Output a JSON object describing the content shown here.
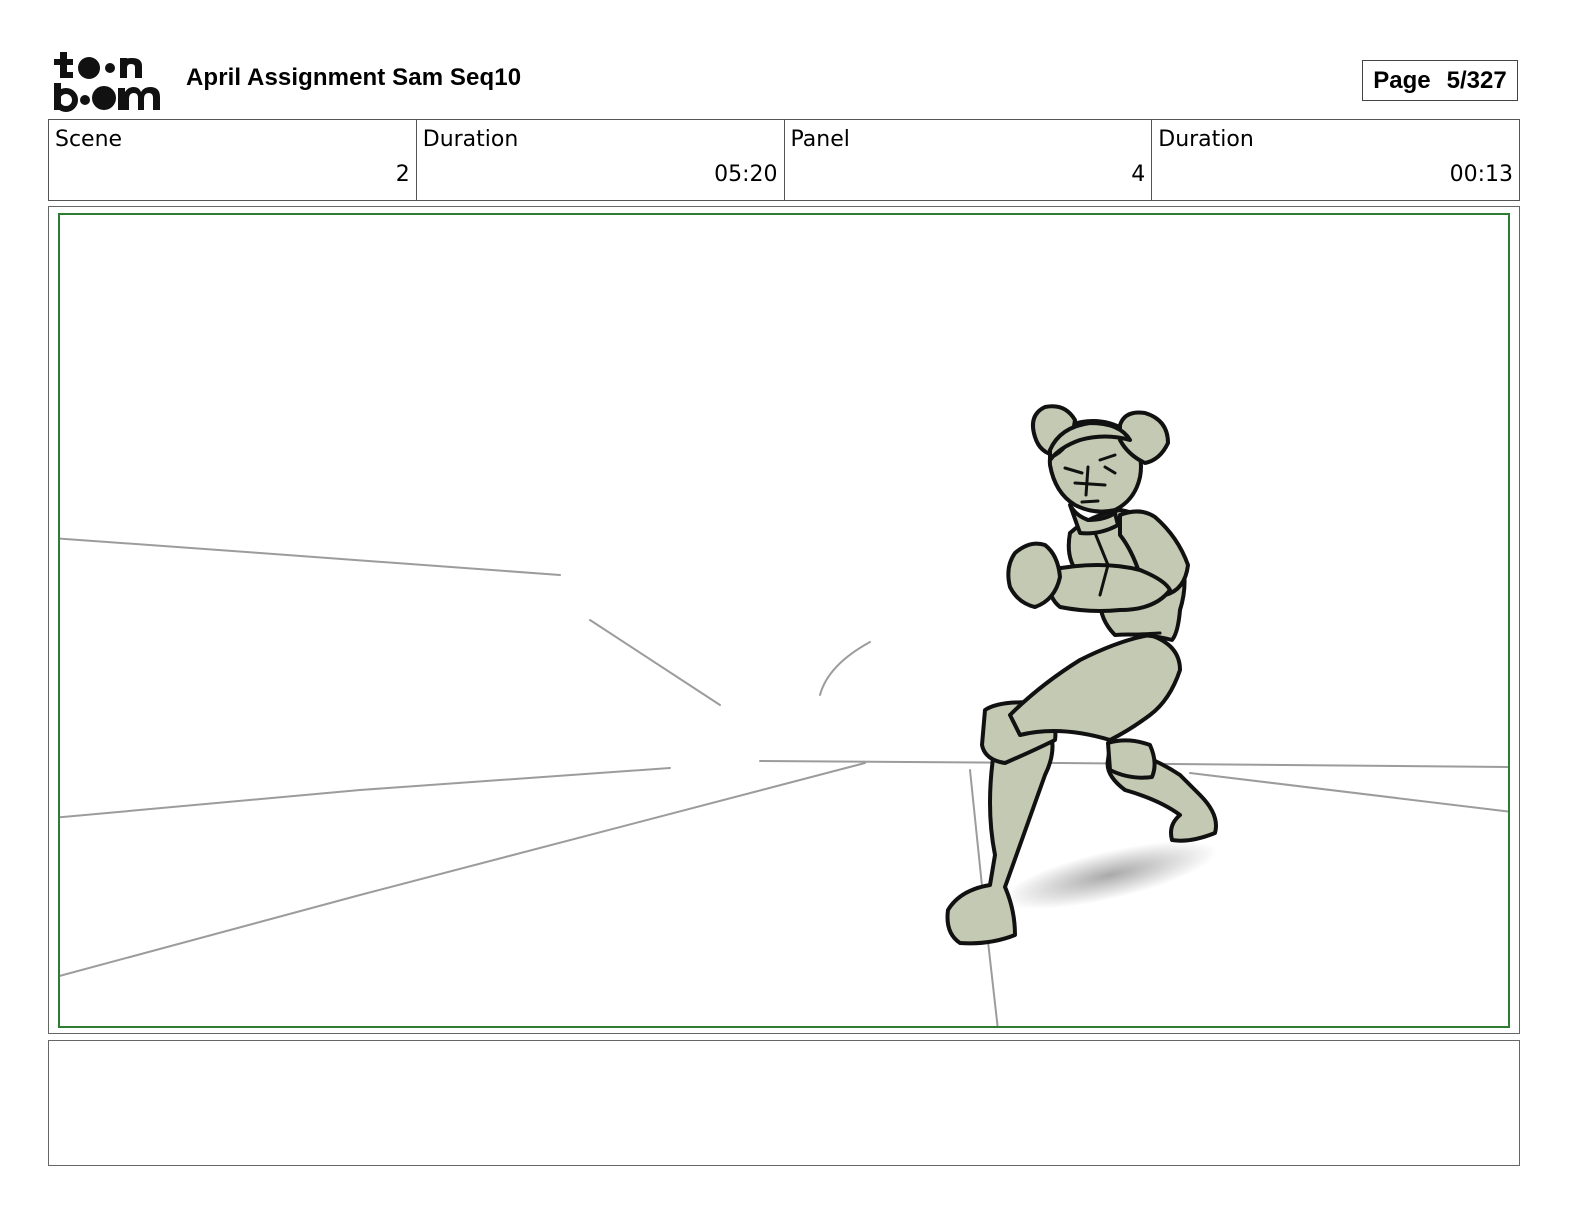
{
  "header": {
    "logo_top": "to•n",
    "logo_bottom": "b••m",
    "title": "April Assignment Sam Seq10",
    "page_label": "Page",
    "page_value": "5/327"
  },
  "info": {
    "scene_label": "Scene",
    "scene_value": "2",
    "scene_duration_label": "Duration",
    "scene_duration_value": "05:20",
    "panel_label": "Panel",
    "panel_value": "4",
    "panel_duration_label": "Duration",
    "panel_duration_value": "00:13"
  },
  "colors": {
    "safe_frame": "#2e7d32",
    "character_fill": "#c3c9b2",
    "ink": "#111111",
    "construction_lines": "#9a9a9a"
  },
  "notes": {
    "text": ""
  }
}
